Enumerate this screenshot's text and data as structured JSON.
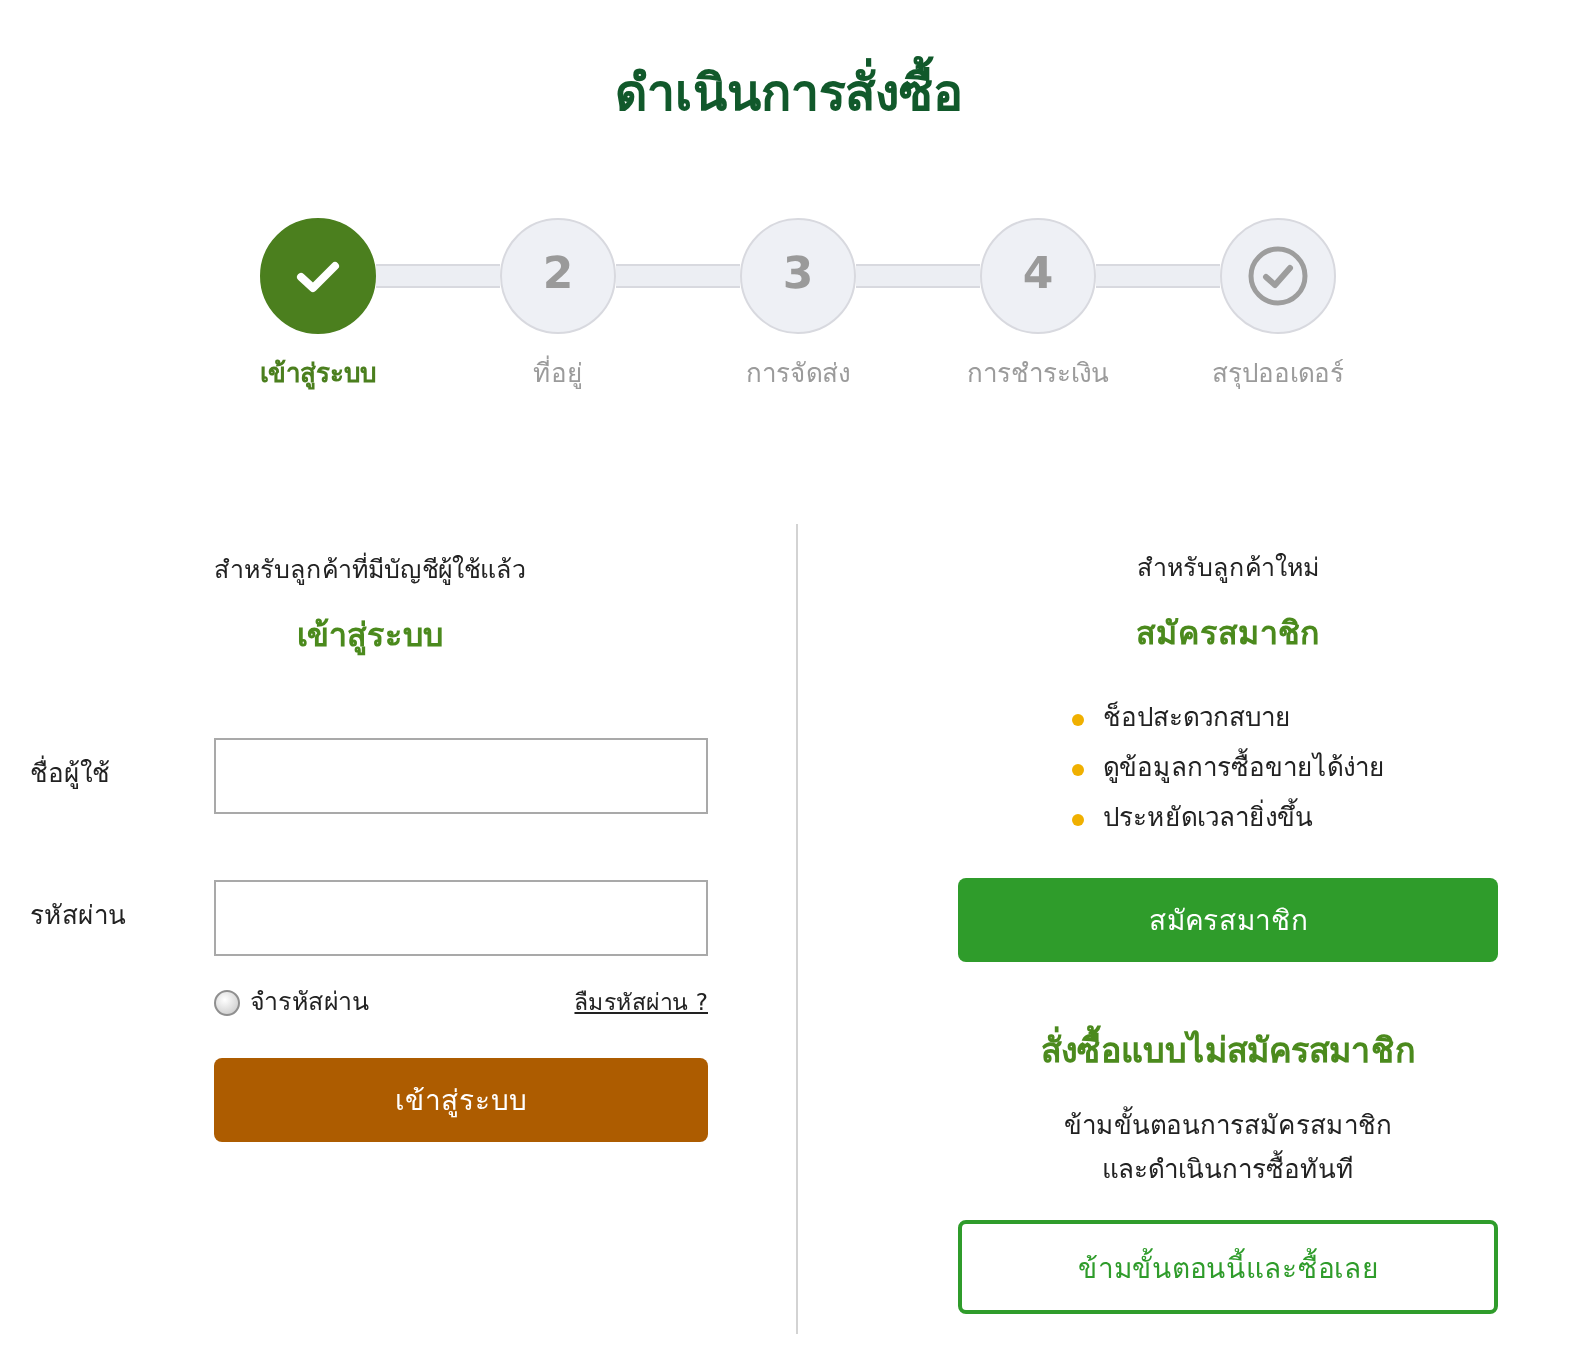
{
  "page": {
    "title": "ดำเนินการสั่งซื้อ"
  },
  "steps": [
    {
      "kind": "check",
      "label": "เข้าสู่ระบบ",
      "selected": true
    },
    {
      "kind": "number",
      "number": "2",
      "label": "ที่อยู่",
      "selected": false
    },
    {
      "kind": "number",
      "number": "3",
      "label": "การจัดส่ง",
      "selected": false
    },
    {
      "kind": "number",
      "number": "4",
      "label": "การชำระเงิน",
      "selected": false
    },
    {
      "kind": "check",
      "label": "สรุปออเดอร์",
      "selected": false
    }
  ],
  "login": {
    "subtitle": "สำหรับลูกค้าที่มีบัญชีผู้ใช้แล้ว",
    "heading": "เข้าสู่ระบบ",
    "fields": [
      {
        "label": "ชื่อผู้ใช้"
      },
      {
        "label": "รหัสผ่าน"
      }
    ],
    "remember": {
      "label": "จำรหัสผ่าน",
      "checked": false
    },
    "forgot_link": "ลืมรหัสผ่าน ?",
    "button": "เข้าสู่ระบบ"
  },
  "signup": {
    "subtitle": "สำหรับลูกค้าใหม่",
    "heading": "สมัครสมาชิก",
    "benefits": [
      "ช็อปสะดวกสบาย",
      "ดูข้อมูลการซื้อขายได้ง่าย",
      "ประหยัดเวลายิ่งขึ้น"
    ],
    "button": "สมัครสมาชิก"
  },
  "guest": {
    "heading": "สั่งซื้อแบบไม่สมัครสมาชิก",
    "description_lines": [
      "ข้ามขั้นตอนการสมัครสมาชิก",
      "และดำเนินการซื้อทันที"
    ],
    "button": "ข้ามขั้นตอนนี้และซื้อเลย"
  }
}
